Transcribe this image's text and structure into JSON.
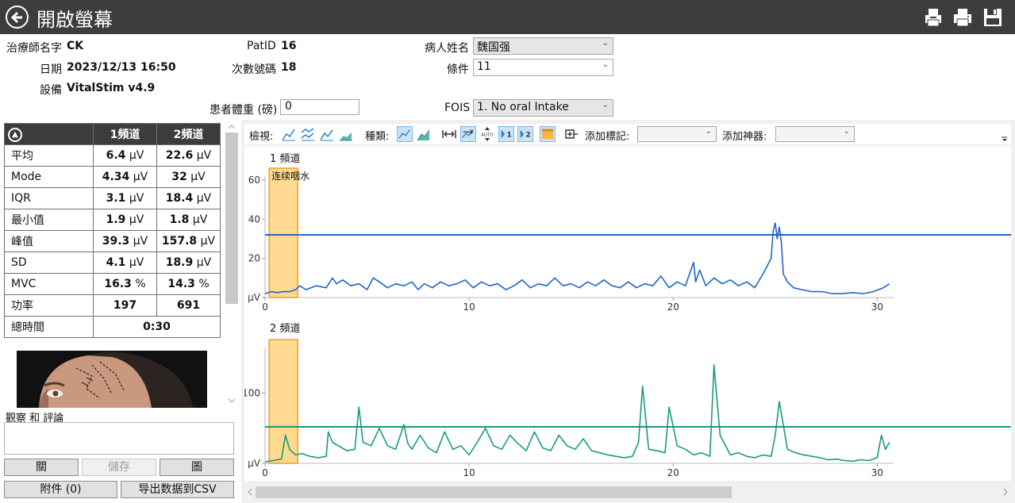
{
  "app": {
    "title": "開啟螢幕"
  },
  "header": {
    "therapist_label": "治療師名字",
    "therapist_value": "CK",
    "date_label": "日期",
    "date_value": "2023/12/13 16:50",
    "device_label": "設備",
    "device_value": "VitalStim v4.9",
    "patid_label": "PatID",
    "patid_value": "16",
    "session_label": "次數號碼",
    "session_value": "18",
    "weight_label": "患者體重 (磅)",
    "weight_value": "0",
    "patient_label": "病人姓名",
    "patient_value": "魏国强",
    "condition_label": "條件",
    "condition_value": "11",
    "fois_label": "FOIS",
    "fois_value": "1. No oral Intake"
  },
  "stats": {
    "col1": "1頻道",
    "col2": "2頻道",
    "rows": [
      {
        "label": "平均",
        "v1": "6.4",
        "u1": " µV",
        "v2": "22.6",
        "u2": " µV"
      },
      {
        "label": "Mode",
        "v1": "4.34",
        "u1": " µV",
        "v2": "32",
        "u2": " µV"
      },
      {
        "label": "IQR",
        "v1": "3.1",
        "u1": " µV",
        "v2": "18.4",
        "u2": " µV"
      },
      {
        "label": "最小值",
        "v1": "1.9",
        "u1": " µV",
        "v2": "1.8",
        "u2": " µV"
      },
      {
        "label": "峰值",
        "v1": "39.3",
        "u1": " µV",
        "v2": "157.8",
        "u2": " µV"
      },
      {
        "label": "SD",
        "v1": "4.1",
        "u1": " µV",
        "v2": "18.9",
        "u2": " µV"
      },
      {
        "label": "MVC",
        "v1": "16.3",
        "u1": " %",
        "v2": "14.3",
        "u2": " %"
      },
      {
        "label": "功率",
        "v1": "197",
        "u1": "",
        "v2": "691",
        "u2": ""
      }
    ],
    "total_label": "總時間",
    "total_value": "0:30"
  },
  "notes": {
    "label": "觀察 和 評論",
    "value": ""
  },
  "buttons": {
    "close": "關",
    "save": "儲存",
    "graph": "圖",
    "attachments": "附件 (0)",
    "export": "导出数据到CSV"
  },
  "toolbar": {
    "view_label": "檢視:",
    "type_label": "種類:",
    "add_marker_label": "添加標記:",
    "add_device_label": "添加神器:",
    "marker_value": "",
    "device_value": ""
  },
  "chart_data": [
    {
      "type": "line",
      "title": "1 頻道",
      "x_ticks": [
        0,
        10,
        20,
        30
      ],
      "y_ticks": [
        0,
        20,
        40,
        60
      ],
      "y_tick_labels": [
        "0 µV",
        "20",
        "40",
        "60"
      ],
      "xlim": [
        0,
        30.8
      ],
      "ylim": [
        0,
        62
      ],
      "color": "#2166c4",
      "threshold": 32,
      "marker": {
        "label": "连续咽水",
        "x_start": 0.2,
        "x_end": 1.6
      },
      "series": [
        {
          "x": [
            0,
            0.3,
            0.6,
            0.9,
            1.2,
            1.5,
            1.7,
            2,
            2.5,
            3,
            3.3,
            3.5,
            3.8,
            4.2,
            4.6,
            5,
            5.3,
            5.6,
            6,
            6.4,
            6.8,
            7.2,
            7.5,
            7.8,
            8.2,
            8.6,
            9,
            9.4,
            9.8,
            10.2,
            10.6,
            11,
            11.4,
            11.8,
            12.2,
            12.6,
            13,
            13.4,
            13.8,
            14.2,
            14.6,
            15,
            15.4,
            15.8,
            16.2,
            16.6,
            17,
            17.4,
            17.8,
            18.2,
            18.6,
            19,
            19.4,
            19.8,
            20.2,
            20.6,
            21,
            21.1,
            21.3,
            21.6,
            22,
            22.4,
            22.8,
            23.2,
            23.6,
            24,
            24.4,
            24.8,
            24.9,
            25,
            25.1,
            25.2,
            25.3,
            25.4,
            25.6,
            25.9,
            26.3,
            26.8,
            27.3,
            27.8,
            28.3,
            28.8,
            29.3,
            29.8,
            30.3,
            30.6
          ],
          "y": [
            2,
            3,
            2.5,
            3,
            3,
            4,
            6,
            4,
            6,
            5,
            10,
            7,
            9,
            6,
            7,
            4,
            10,
            8,
            5,
            7,
            6,
            8,
            4,
            7,
            5,
            8,
            6,
            7,
            9,
            5,
            8,
            6,
            7,
            4,
            6,
            9,
            5,
            7,
            6,
            10,
            6,
            7,
            5,
            8,
            6,
            9,
            6,
            5,
            8,
            5,
            7,
            6,
            11,
            5,
            8,
            6,
            18,
            8,
            14,
            6,
            10,
            7,
            9,
            6,
            8,
            5,
            12,
            20,
            34,
            38,
            30,
            36,
            28,
            12,
            8,
            5,
            4,
            3,
            3,
            2,
            2,
            2.5,
            2,
            3,
            5,
            7
          ]
        }
      ]
    },
    {
      "type": "line",
      "title": "2 頻道",
      "x_ticks": [
        0,
        10,
        20,
        30
      ],
      "y_ticks": [
        0,
        100
      ],
      "y_tick_labels": [
        "0 µV",
        "100"
      ],
      "xlim": [
        0,
        30.8
      ],
      "ylim": [
        0,
        165
      ],
      "color": "#1a9a80",
      "threshold": 52,
      "marker": {
        "label": "",
        "x_start": 0.2,
        "x_end": 1.6
      },
      "series": [
        {
          "x": [
            0,
            0.4,
            0.8,
            1,
            1.2,
            1.5,
            1.8,
            2.2,
            2.6,
            3,
            3.1,
            3.3,
            3.6,
            4,
            4.4,
            4.6,
            4.8,
            5.2,
            5.6,
            6,
            6.4,
            6.8,
            7,
            7.2,
            7.6,
            8,
            8.4,
            8.8,
            9.2,
            9.6,
            10,
            10.4,
            10.8,
            11.2,
            11.6,
            12,
            12.4,
            12.8,
            13.2,
            13.6,
            14,
            14.4,
            14.8,
            15.2,
            15.6,
            16,
            16.4,
            16.8,
            17.2,
            17.6,
            18,
            18.3,
            18.5,
            18.8,
            19.2,
            19.6,
            19.8,
            20.2,
            20.6,
            21,
            21.4,
            21.8,
            22,
            22.3,
            22.8,
            23.2,
            23.6,
            24,
            24.4,
            24.8,
            25,
            25.2,
            25.6,
            26,
            26.4,
            26.8,
            27.2,
            27.6,
            28,
            28.4,
            28.8,
            29.2,
            29.6,
            30,
            30.2,
            30.4,
            30.6
          ],
          "y": [
            2,
            4,
            6,
            40,
            20,
            12,
            14,
            10,
            8,
            10,
            45,
            30,
            25,
            18,
            20,
            80,
            30,
            25,
            50,
            25,
            20,
            55,
            28,
            20,
            40,
            22,
            15,
            45,
            20,
            25,
            12,
            30,
            50,
            25,
            20,
            40,
            28,
            18,
            45,
            22,
            18,
            40,
            25,
            20,
            35,
            18,
            15,
            12,
            10,
            8,
            10,
            30,
            110,
            20,
            18,
            15,
            80,
            25,
            20,
            12,
            15,
            10,
            140,
            40,
            12,
            15,
            10,
            8,
            12,
            10,
            40,
            88,
            20,
            15,
            12,
            10,
            8,
            5,
            6,
            4,
            3,
            5,
            4,
            8,
            40,
            20,
            30
          ]
        }
      ]
    }
  ],
  "colors": {
    "titlebar": "#3d3d3d",
    "marker_fill": "#ffd98f",
    "marker_border": "#f0a020",
    "ch1": "#2166c4",
    "ch2": "#1a9a80"
  }
}
